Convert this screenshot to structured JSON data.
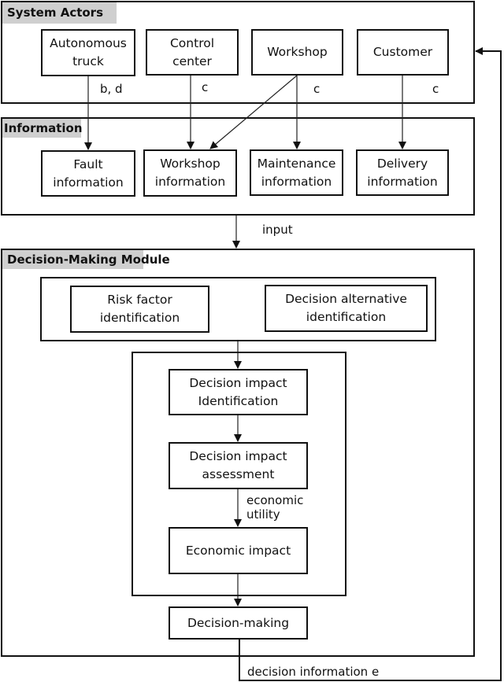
{
  "diagram": {
    "groups": {
      "system_actors": {
        "label": "System Actors"
      },
      "information": {
        "label": "Information"
      },
      "decision_module": {
        "label": "Decision-Making Module"
      }
    },
    "actors": [
      {
        "id": "autonomous-truck",
        "label": "Autonomous\ntruck",
        "edge_label": "b, d"
      },
      {
        "id": "control-center",
        "label": "Control\ncenter",
        "edge_label": "c"
      },
      {
        "id": "workshop",
        "label": "Workshop",
        "edge_label": "c"
      },
      {
        "id": "customer",
        "label": "Customer",
        "edge_label": "c"
      }
    ],
    "information": [
      {
        "id": "fault-information",
        "label": "Fault\ninformation"
      },
      {
        "id": "workshop-information",
        "label": "Workshop\ninformation"
      },
      {
        "id": "maintenance-information",
        "label": "Maintenance\ninformation"
      },
      {
        "id": "delivery-information",
        "label": "Delivery\ninformation"
      }
    ],
    "input_label": "input",
    "identification": [
      {
        "id": "risk-factor-identification",
        "label": "Risk  factor\nidentification"
      },
      {
        "id": "decision-alternative-identification",
        "label": "Decision alternative\nidentification"
      }
    ],
    "impact_steps": [
      {
        "id": "decision-impact-identification",
        "label": "Decision impact\nIdentification"
      },
      {
        "id": "decision-impact-assessment",
        "label": "Decision impact\nassessment"
      },
      {
        "id": "economic-impact",
        "label": "Economic impact"
      }
    ],
    "economic_utility_label": "economic\nutility",
    "decision_making": {
      "label": "Decision-making"
    },
    "feedback_label": "decision information e",
    "edges": [
      {
        "from": "autonomous-truck",
        "to": "fault-information",
        "label": "b, d"
      },
      {
        "from": "control-center",
        "to": "workshop-information",
        "label": "c"
      },
      {
        "from": "workshop",
        "to": "workshop-information",
        "label": ""
      },
      {
        "from": "workshop",
        "to": "maintenance-information",
        "label": "c"
      },
      {
        "from": "customer",
        "to": "delivery-information",
        "label": "c"
      },
      {
        "from": "information",
        "to": "decision-making-module",
        "label": "input"
      },
      {
        "from": "identification",
        "to": "decision-impact-identification",
        "label": ""
      },
      {
        "from": "decision-impact-identification",
        "to": "decision-impact-assessment",
        "label": ""
      },
      {
        "from": "decision-impact-assessment",
        "to": "economic-impact",
        "label": "economic utility"
      },
      {
        "from": "economic-impact",
        "to": "decision-making",
        "label": ""
      },
      {
        "from": "decision-making",
        "to": "system-actors",
        "label": "decision information e"
      }
    ]
  }
}
